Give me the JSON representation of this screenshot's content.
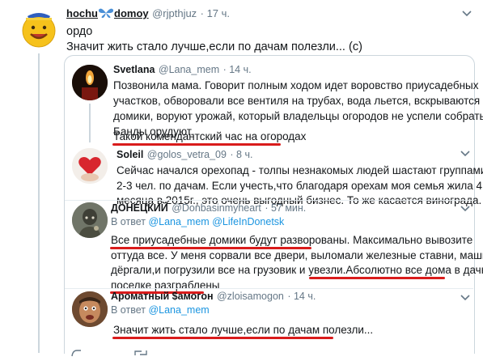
{
  "main_tweet": {
    "name_part1": "hochu",
    "name_part2": "domoy",
    "handle": "@rjpthjuz",
    "time": "· 17 ч.",
    "line1": "ордо",
    "line2": "Значит жить стало лучше,если по дачам полезли... (с)"
  },
  "quoted": [
    {
      "name": "Svetlana",
      "handle": "@Lana_mem",
      "time": "· 14 ч.",
      "lines": [
        "Позвонила мама. Говорит полным ходом идет воровство приусадебных",
        "участков, обворовали все вентиля на трубах, вода льется, вскрываются",
        "домики, воруют урожай, который владельцы огородов не успели собрать.",
        "Банды орудуют.",
        "Такой комендантский час на огородах"
      ]
    },
    {
      "name": "Soleil",
      "handle": "@golos_vetra_09",
      "time": "· 8 ч.",
      "lines": [
        "Сейчас начался орехопад - толпы незнакомых людей шастают группами по",
        "2-3 чел. по дачам.  Если учесть,что благодаря орехам моя семья жила 4",
        "месяца в 2015г., это очень выгодный бизнес. То же касается винограда."
      ]
    },
    {
      "name": "ДОНЕЦКИЙ",
      "handle": "@Donbasinmyheart",
      "time": "· 57 мин.",
      "reply_prefix": "В ответ",
      "reply_to1": "@Lana_mem",
      "reply_to2": "@LifeInDonetsk",
      "lines": [
        "Все приусадебные домики будут разворованы. Максимально вывозите",
        "оттуда все. У меня сорвали все двери, выломали железные ставни, машиной",
        "дёргали,и погрузили все на грузовик и увезли.Абсолютно все дома в дачном",
        "поселке разграблены"
      ]
    },
    {
      "name": "Ароматный $амогон",
      "handle": "@zloisamogon",
      "time": "· 14 ч.",
      "reply_prefix": "В ответ",
      "reply_to1": "@Lana_mem",
      "lines": [
        "Значит жить стало лучше,если по дачам полезли..."
      ]
    }
  ],
  "colors": {
    "underline": "#d91c1c",
    "link": "#1b95e0",
    "muted": "#657786",
    "border": "#ccd6dd"
  }
}
